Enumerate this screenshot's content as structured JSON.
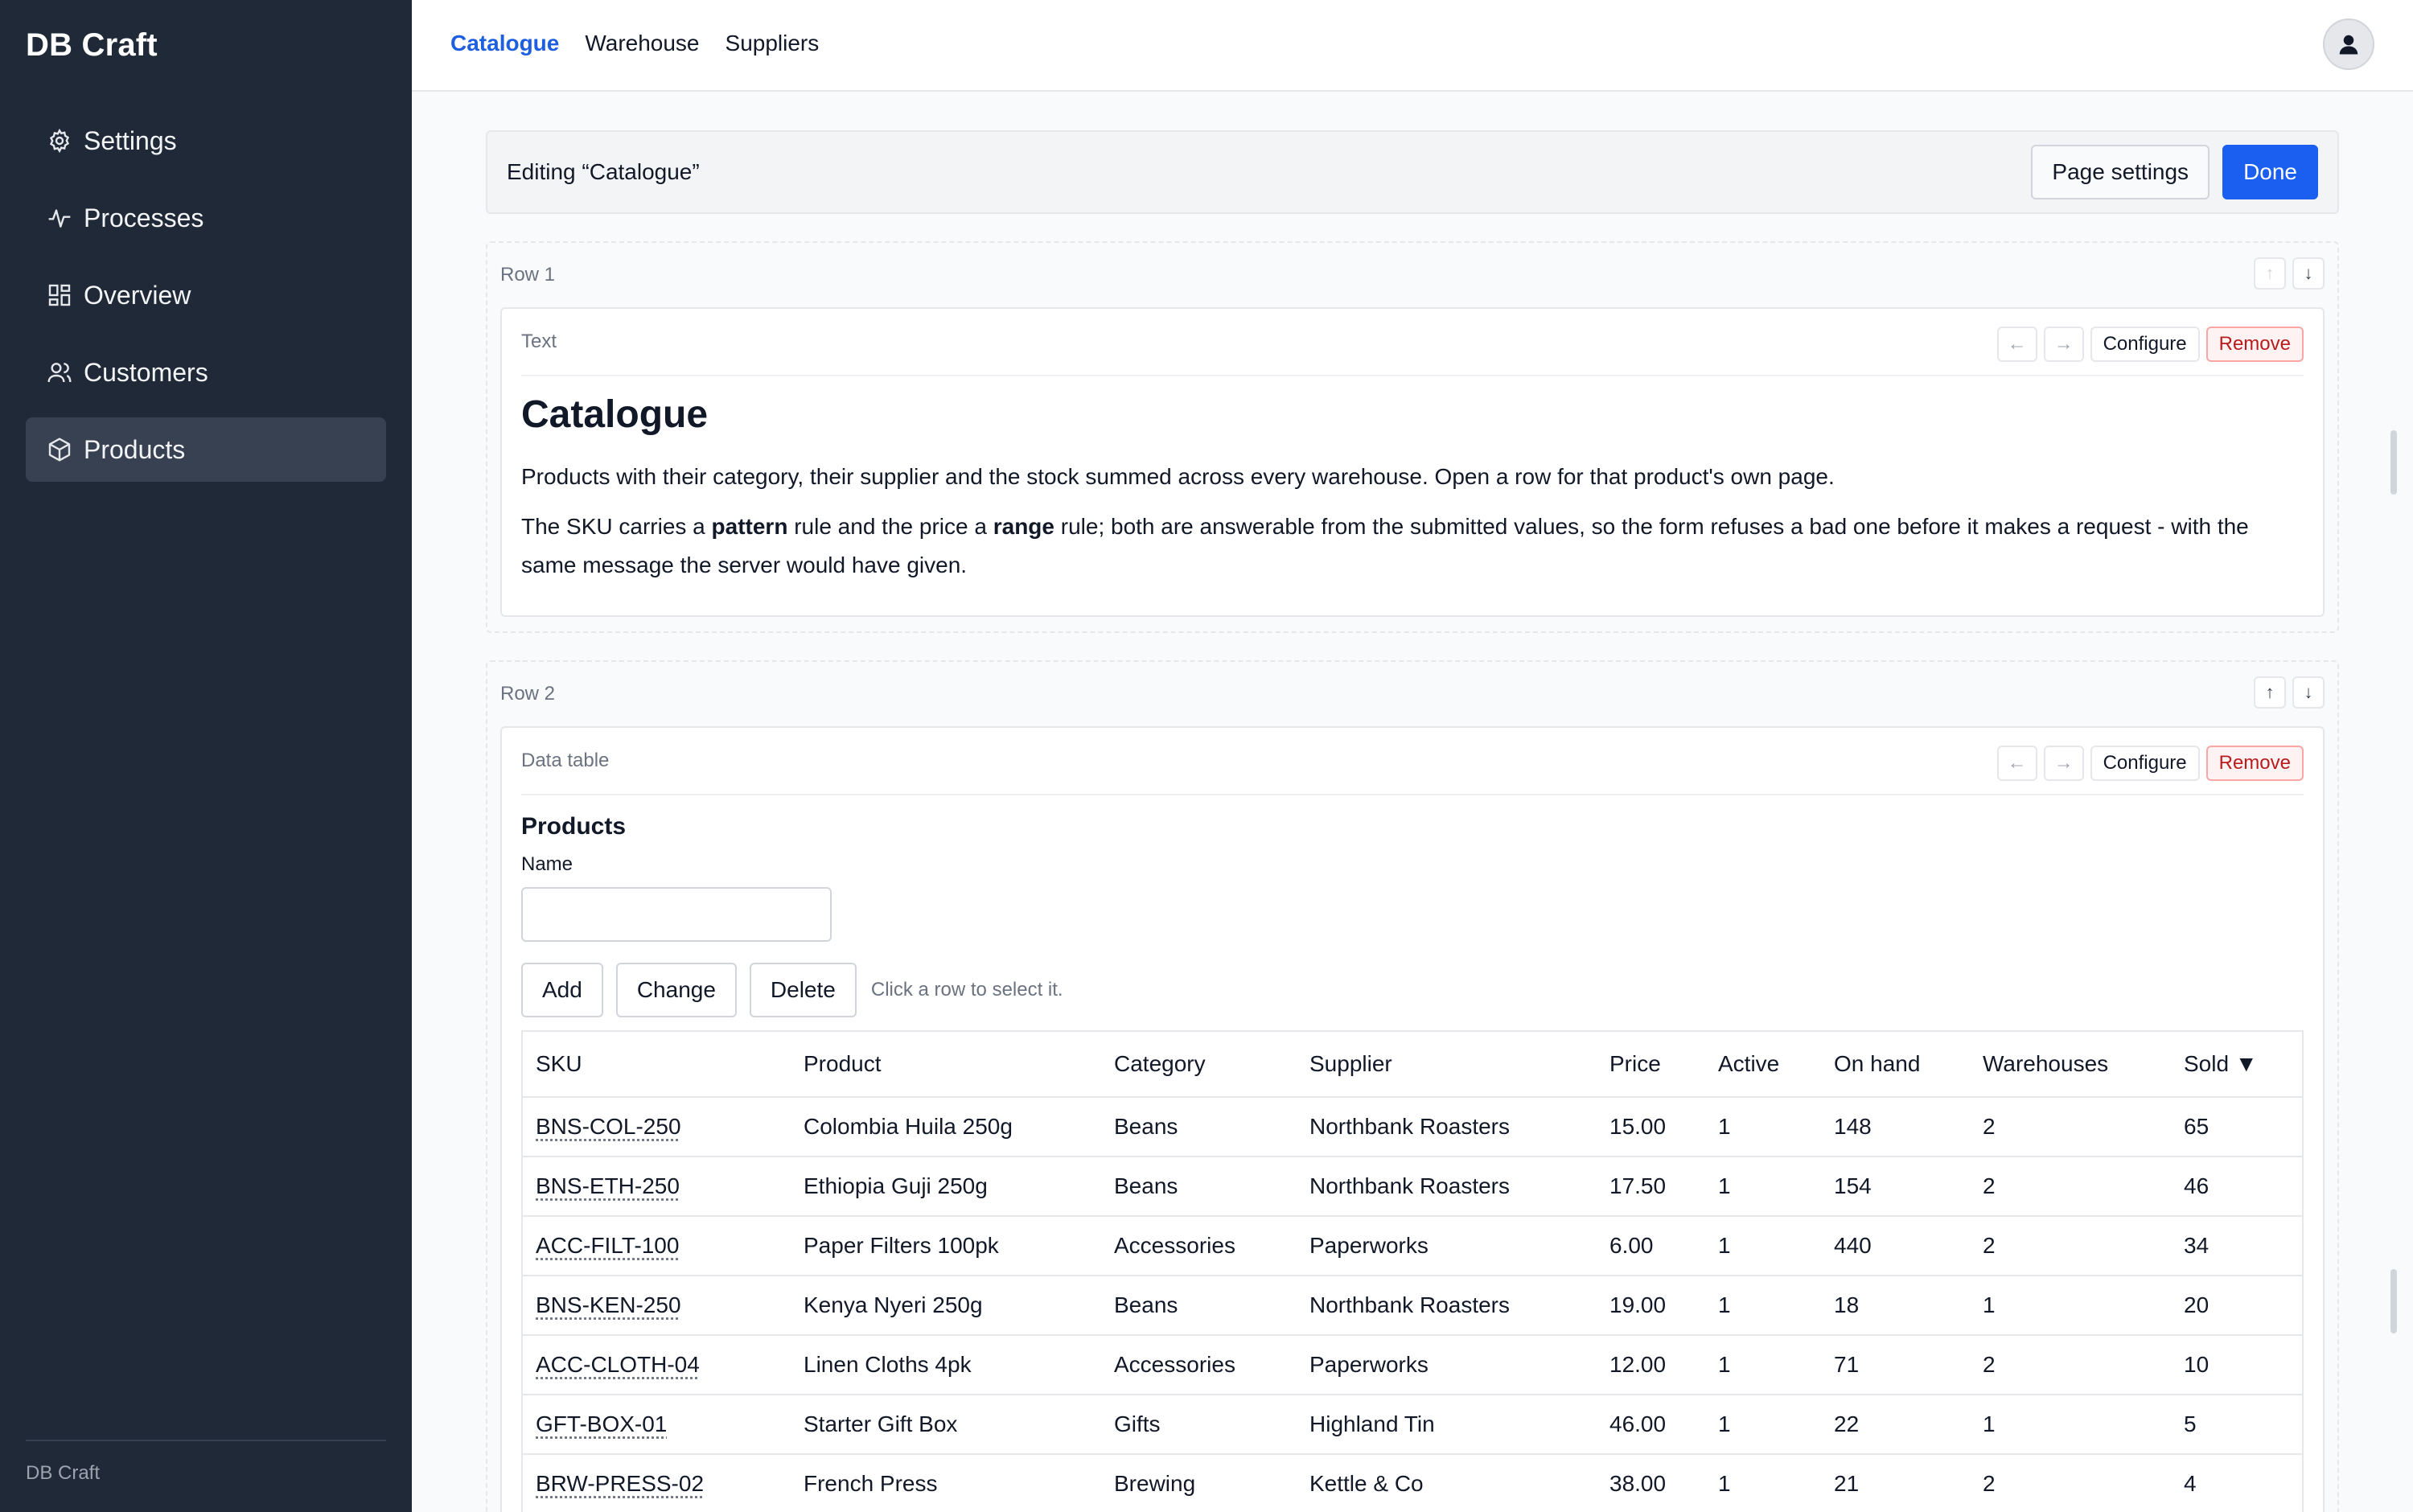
{
  "app": {
    "brand": "DB Craft",
    "footer": "DB Craft"
  },
  "sidebar": {
    "items": [
      {
        "label": "Settings",
        "icon": "gear-icon"
      },
      {
        "label": "Processes",
        "icon": "activity-icon"
      },
      {
        "label": "Overview",
        "icon": "dashboard-icon"
      },
      {
        "label": "Customers",
        "icon": "users-icon"
      },
      {
        "label": "Products",
        "icon": "box-icon",
        "active": true
      }
    ]
  },
  "topbar": {
    "tabs": [
      {
        "label": "Catalogue",
        "active": true
      },
      {
        "label": "Warehouse"
      },
      {
        "label": "Suppliers"
      }
    ]
  },
  "editor": {
    "title": "Editing “Catalogue”",
    "page_settings_label": "Page settings",
    "done_label": "Done"
  },
  "controls": {
    "left_arrow": "←",
    "right_arrow": "→",
    "up_arrow": "↑",
    "down_arrow": "↓",
    "configure": "Configure",
    "remove": "Remove"
  },
  "row1": {
    "label": "Row 1",
    "widget_type": "Text",
    "heading": "Catalogue",
    "para1": "Products with their category, their supplier and the stock summed across every warehouse. Open a row for that product's own page.",
    "para2_a": "The SKU carries a ",
    "para2_b": "pattern",
    "para2_c": " rule and the price a ",
    "para2_d": "range",
    "para2_e": " rule; both are answerable from the submitted values, so the form refuses a bad one before it makes a request - with the same message the server would have given."
  },
  "row2": {
    "label": "Row 2",
    "widget_type": "Data table",
    "table_title": "Products",
    "name_label": "Name",
    "name_value": "",
    "add_label": "Add",
    "change_label": "Change",
    "delete_label": "Delete",
    "hint": "Click a row to select it.",
    "columns": [
      "SKU",
      "Product",
      "Category",
      "Supplier",
      "Price",
      "Active",
      "On hand",
      "Warehouses",
      "Sold ▼"
    ],
    "rows": [
      [
        "BNS-COL-250",
        "Colombia Huila 250g",
        "Beans",
        "Northbank Roasters",
        "15.00",
        "1",
        "148",
        "2",
        "65"
      ],
      [
        "BNS-ETH-250",
        "Ethiopia Guji 250g",
        "Beans",
        "Northbank Roasters",
        "17.50",
        "1",
        "154",
        "2",
        "46"
      ],
      [
        "ACC-FILT-100",
        "Paper Filters 100pk",
        "Accessories",
        "Paperworks",
        "6.00",
        "1",
        "440",
        "2",
        "34"
      ],
      [
        "BNS-KEN-250",
        "Kenya Nyeri 250g",
        "Beans",
        "Northbank Roasters",
        "19.00",
        "1",
        "18",
        "1",
        "20"
      ],
      [
        "ACC-CLOTH-04",
        "Linen Cloths 4pk",
        "Accessories",
        "Paperworks",
        "12.00",
        "1",
        "71",
        "2",
        "10"
      ],
      [
        "GFT-BOX-01",
        "Starter Gift Box",
        "Gifts",
        "Highland Tin",
        "46.00",
        "1",
        "22",
        "1",
        "5"
      ],
      [
        "BRW-PRESS-02",
        "French Press",
        "Brewing",
        "Kettle & Co",
        "38.00",
        "1",
        "21",
        "2",
        "4"
      ]
    ]
  }
}
